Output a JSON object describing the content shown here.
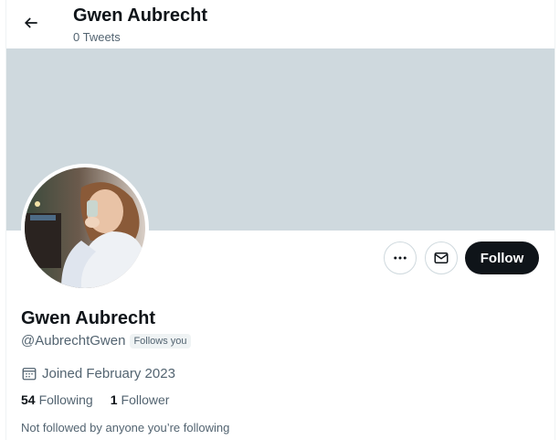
{
  "header": {
    "title": "Gwen Aubrecht",
    "tweet_count": "0 Tweets",
    "back_icon": "arrow-left-icon"
  },
  "banner": {
    "color": "#cfd9de"
  },
  "profile": {
    "display_name": "Gwen Aubrecht",
    "handle": "@AubrechtGwen",
    "follows_you_badge": "Follows you",
    "joined": "Joined February 2023",
    "following_count": "54",
    "following_label": "Following",
    "followers_count": "1",
    "followers_label": "Follower",
    "not_followed_text": "Not followed by anyone you’re following"
  },
  "actions": {
    "more_icon": "more-dots-icon",
    "message_icon": "envelope-icon",
    "follow_label": "Follow"
  },
  "colors": {
    "text_primary": "#0f1419",
    "text_secondary": "#536471",
    "follow_button_bg": "#0f1419",
    "border": "#cfd9de"
  }
}
